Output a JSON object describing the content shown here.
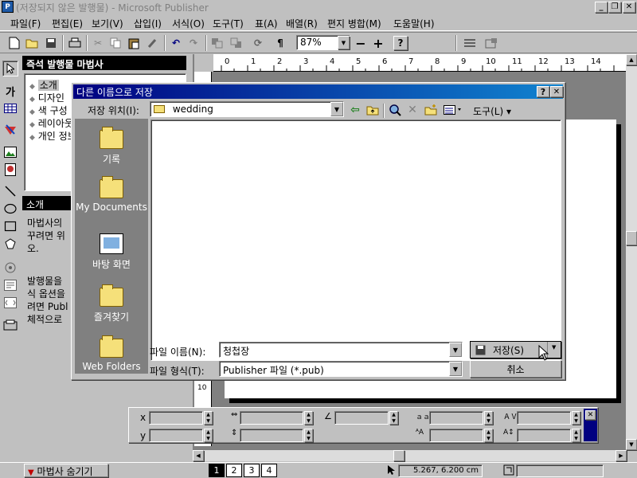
{
  "app": {
    "title": "(저장되지 않은 발행물) - Microsoft Publisher",
    "icon_label": "P",
    "caption_buttons": {
      "minimize": "_",
      "restore": "❐",
      "close": "✕"
    }
  },
  "menu": {
    "items": [
      "파일(F)",
      "편집(E)",
      "보기(V)",
      "삽입(I)",
      "서식(O)",
      "도구(T)",
      "표(A)",
      "배열(R)",
      "편지 병합(M)",
      "도움말(H)"
    ]
  },
  "toolbar": {
    "zoom": "87%",
    "zoom_out": "−",
    "zoom_in": "+",
    "help": "?"
  },
  "toolbox": {
    "text_tool": "가"
  },
  "wizard": {
    "title": "즉석 발행물 마법사",
    "items": [
      "소개",
      "디자인",
      "색 구성",
      "레이아웃",
      "개인 정보"
    ],
    "intro_title": "소개",
    "intro_text_1": "마법사의 꾸려면 위 오.",
    "intro_text_2": "발행물을 식 옵션을 려면 Publ 체적으로"
  },
  "ruler": {
    "h_ticks": [
      "0",
      "1",
      "2",
      "3",
      "4",
      "5",
      "6",
      "7",
      "8",
      "9",
      "10",
      "11",
      "12",
      "13",
      "14"
    ],
    "v_ticks": [
      "10"
    ]
  },
  "measurement": {
    "x_label": "x",
    "y_label": "y"
  },
  "status": {
    "hide_wizard": "마법사 숨기기",
    "pages": [
      "1",
      "2",
      "3",
      "4"
    ],
    "coords": "5.267, 6.200 cm"
  },
  "dialog": {
    "title": "다른 이름으로 저장",
    "help_btn": "?",
    "close_btn": "✕",
    "location_label": "저장 위치(I):",
    "location_value": "wedding",
    "tools_label": "도구(L) ▾",
    "places": [
      {
        "name": "history-place",
        "label": "기록"
      },
      {
        "name": "my-documents-place",
        "label": "My Documents"
      },
      {
        "name": "desktop-place",
        "label": "바탕 화면"
      },
      {
        "name": "favorites-place",
        "label": "즐겨찾기"
      },
      {
        "name": "web-folders-place",
        "label": "Web Folders"
      }
    ],
    "filename_label": "파일 이름(N):",
    "filename_value": "청첩장",
    "filetype_label": "파일 형식(T):",
    "filetype_value": "Publisher 파일  (*.pub)",
    "save_btn": "저장(S)",
    "cancel_btn": "취소"
  }
}
